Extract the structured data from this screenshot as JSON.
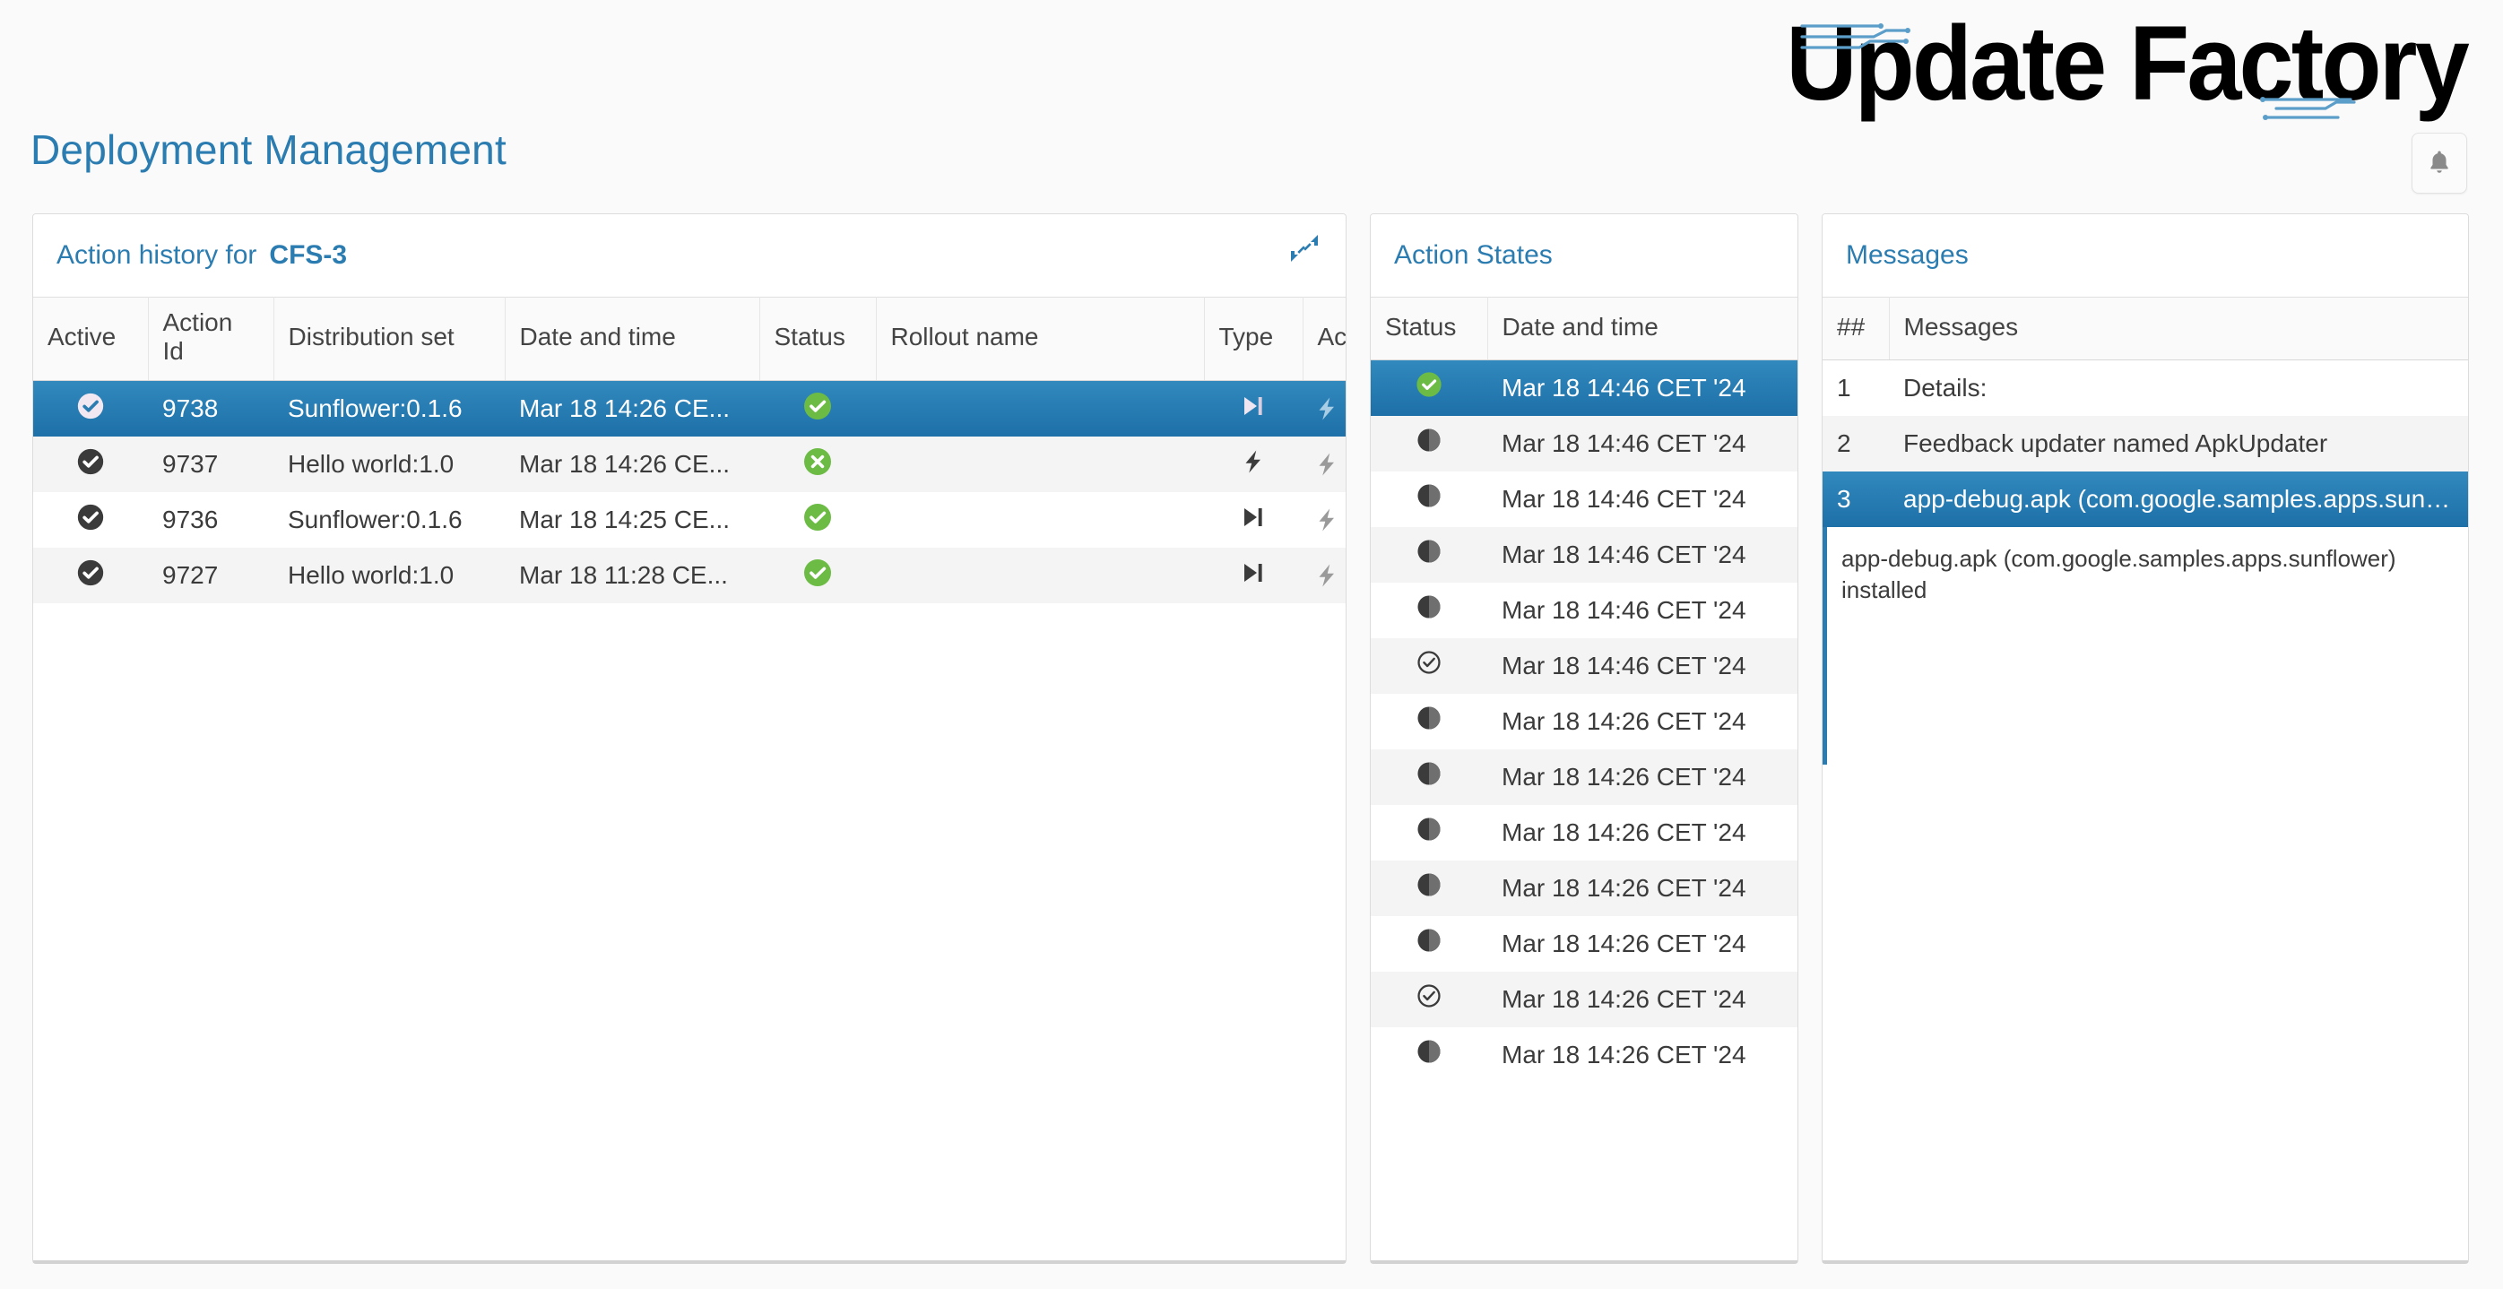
{
  "brand": {
    "name": "Update Factory",
    "accent": "#2b7cb0"
  },
  "header": {
    "page_title": "Deployment Management",
    "bell_icon": "bell-icon"
  },
  "history_panel": {
    "title_prefix": "Action history for",
    "target": "CFS-3",
    "collapse_icon": "collapse-arrows-icon",
    "menu_icon": "hamburger-menu-icon",
    "columns": [
      "Active",
      "Action Id",
      "Distribution set",
      "Date and time",
      "Status",
      "Rollout name",
      "Type",
      "Actions",
      ""
    ],
    "rows": [
      {
        "active": "check-circle-filled-icon",
        "id": "9738",
        "distribution_set": "Sunflower:0.1.6",
        "datetime": "Mar 18 14:26 CE...",
        "status": "status-success-icon",
        "rollout": "",
        "type": "skip-to-end-icon",
        "selected": true
      },
      {
        "active": "check-circle-filled-icon",
        "id": "9737",
        "distribution_set": "Hello world:1.0",
        "datetime": "Mar 18 14:26 CE...",
        "status": "status-error-icon",
        "rollout": "",
        "type": "lightning-bolt-icon",
        "selected": false
      },
      {
        "active": "check-circle-filled-icon",
        "id": "9736",
        "distribution_set": "Sunflower:0.1.6",
        "datetime": "Mar 18 14:25 CE...",
        "status": "status-success-icon",
        "rollout": "",
        "type": "skip-to-end-icon",
        "selected": false
      },
      {
        "active": "check-circle-filled-icon",
        "id": "9727",
        "distribution_set": "Hello world:1.0",
        "datetime": "Mar 18 11:28 CE...",
        "status": "status-success-icon",
        "rollout": "",
        "type": "skip-to-end-icon",
        "selected": false
      }
    ],
    "row_actions": [
      "cancel-icon",
      "force-lightning-icon",
      "force-quit-icon"
    ]
  },
  "states_panel": {
    "title": "Action States",
    "columns": [
      "Status",
      "Date and time"
    ],
    "rows": [
      {
        "status": "status-finished-icon",
        "datetime": "Mar 18 14:46 CET '24",
        "selected": true
      },
      {
        "status": "status-running-icon",
        "datetime": "Mar 18 14:46 CET '24",
        "selected": false
      },
      {
        "status": "status-running-icon",
        "datetime": "Mar 18 14:46 CET '24",
        "selected": false
      },
      {
        "status": "status-running-icon",
        "datetime": "Mar 18 14:46 CET '24",
        "selected": false
      },
      {
        "status": "status-running-icon",
        "datetime": "Mar 18 14:46 CET '24",
        "selected": false
      },
      {
        "status": "status-download-icon",
        "datetime": "Mar 18 14:46 CET '24",
        "selected": false
      },
      {
        "status": "status-running-icon",
        "datetime": "Mar 18 14:26 CET '24",
        "selected": false
      },
      {
        "status": "status-running-icon",
        "datetime": "Mar 18 14:26 CET '24",
        "selected": false
      },
      {
        "status": "status-running-icon",
        "datetime": "Mar 18 14:26 CET '24",
        "selected": false
      },
      {
        "status": "status-running-icon",
        "datetime": "Mar 18 14:26 CET '24",
        "selected": false
      },
      {
        "status": "status-running-icon",
        "datetime": "Mar 18 14:26 CET '24",
        "selected": false
      },
      {
        "status": "status-download-icon",
        "datetime": "Mar 18 14:26 CET '24",
        "selected": false
      },
      {
        "status": "status-running-icon",
        "datetime": "Mar 18 14:26 CET '24",
        "selected": false
      }
    ]
  },
  "messages_panel": {
    "title": "Messages",
    "columns": [
      "##",
      "Messages"
    ],
    "rows": [
      {
        "no": "1",
        "text": "Details:",
        "selected": false
      },
      {
        "no": "2",
        "text": "Feedback updater named ApkUpdater",
        "selected": false
      },
      {
        "no": "3",
        "text": "app-debug.apk (com.google.samples.apps.sunflo...",
        "selected": true
      }
    ],
    "detail": "app-debug.apk (com.google.samples.apps.sunflower) installed"
  }
}
